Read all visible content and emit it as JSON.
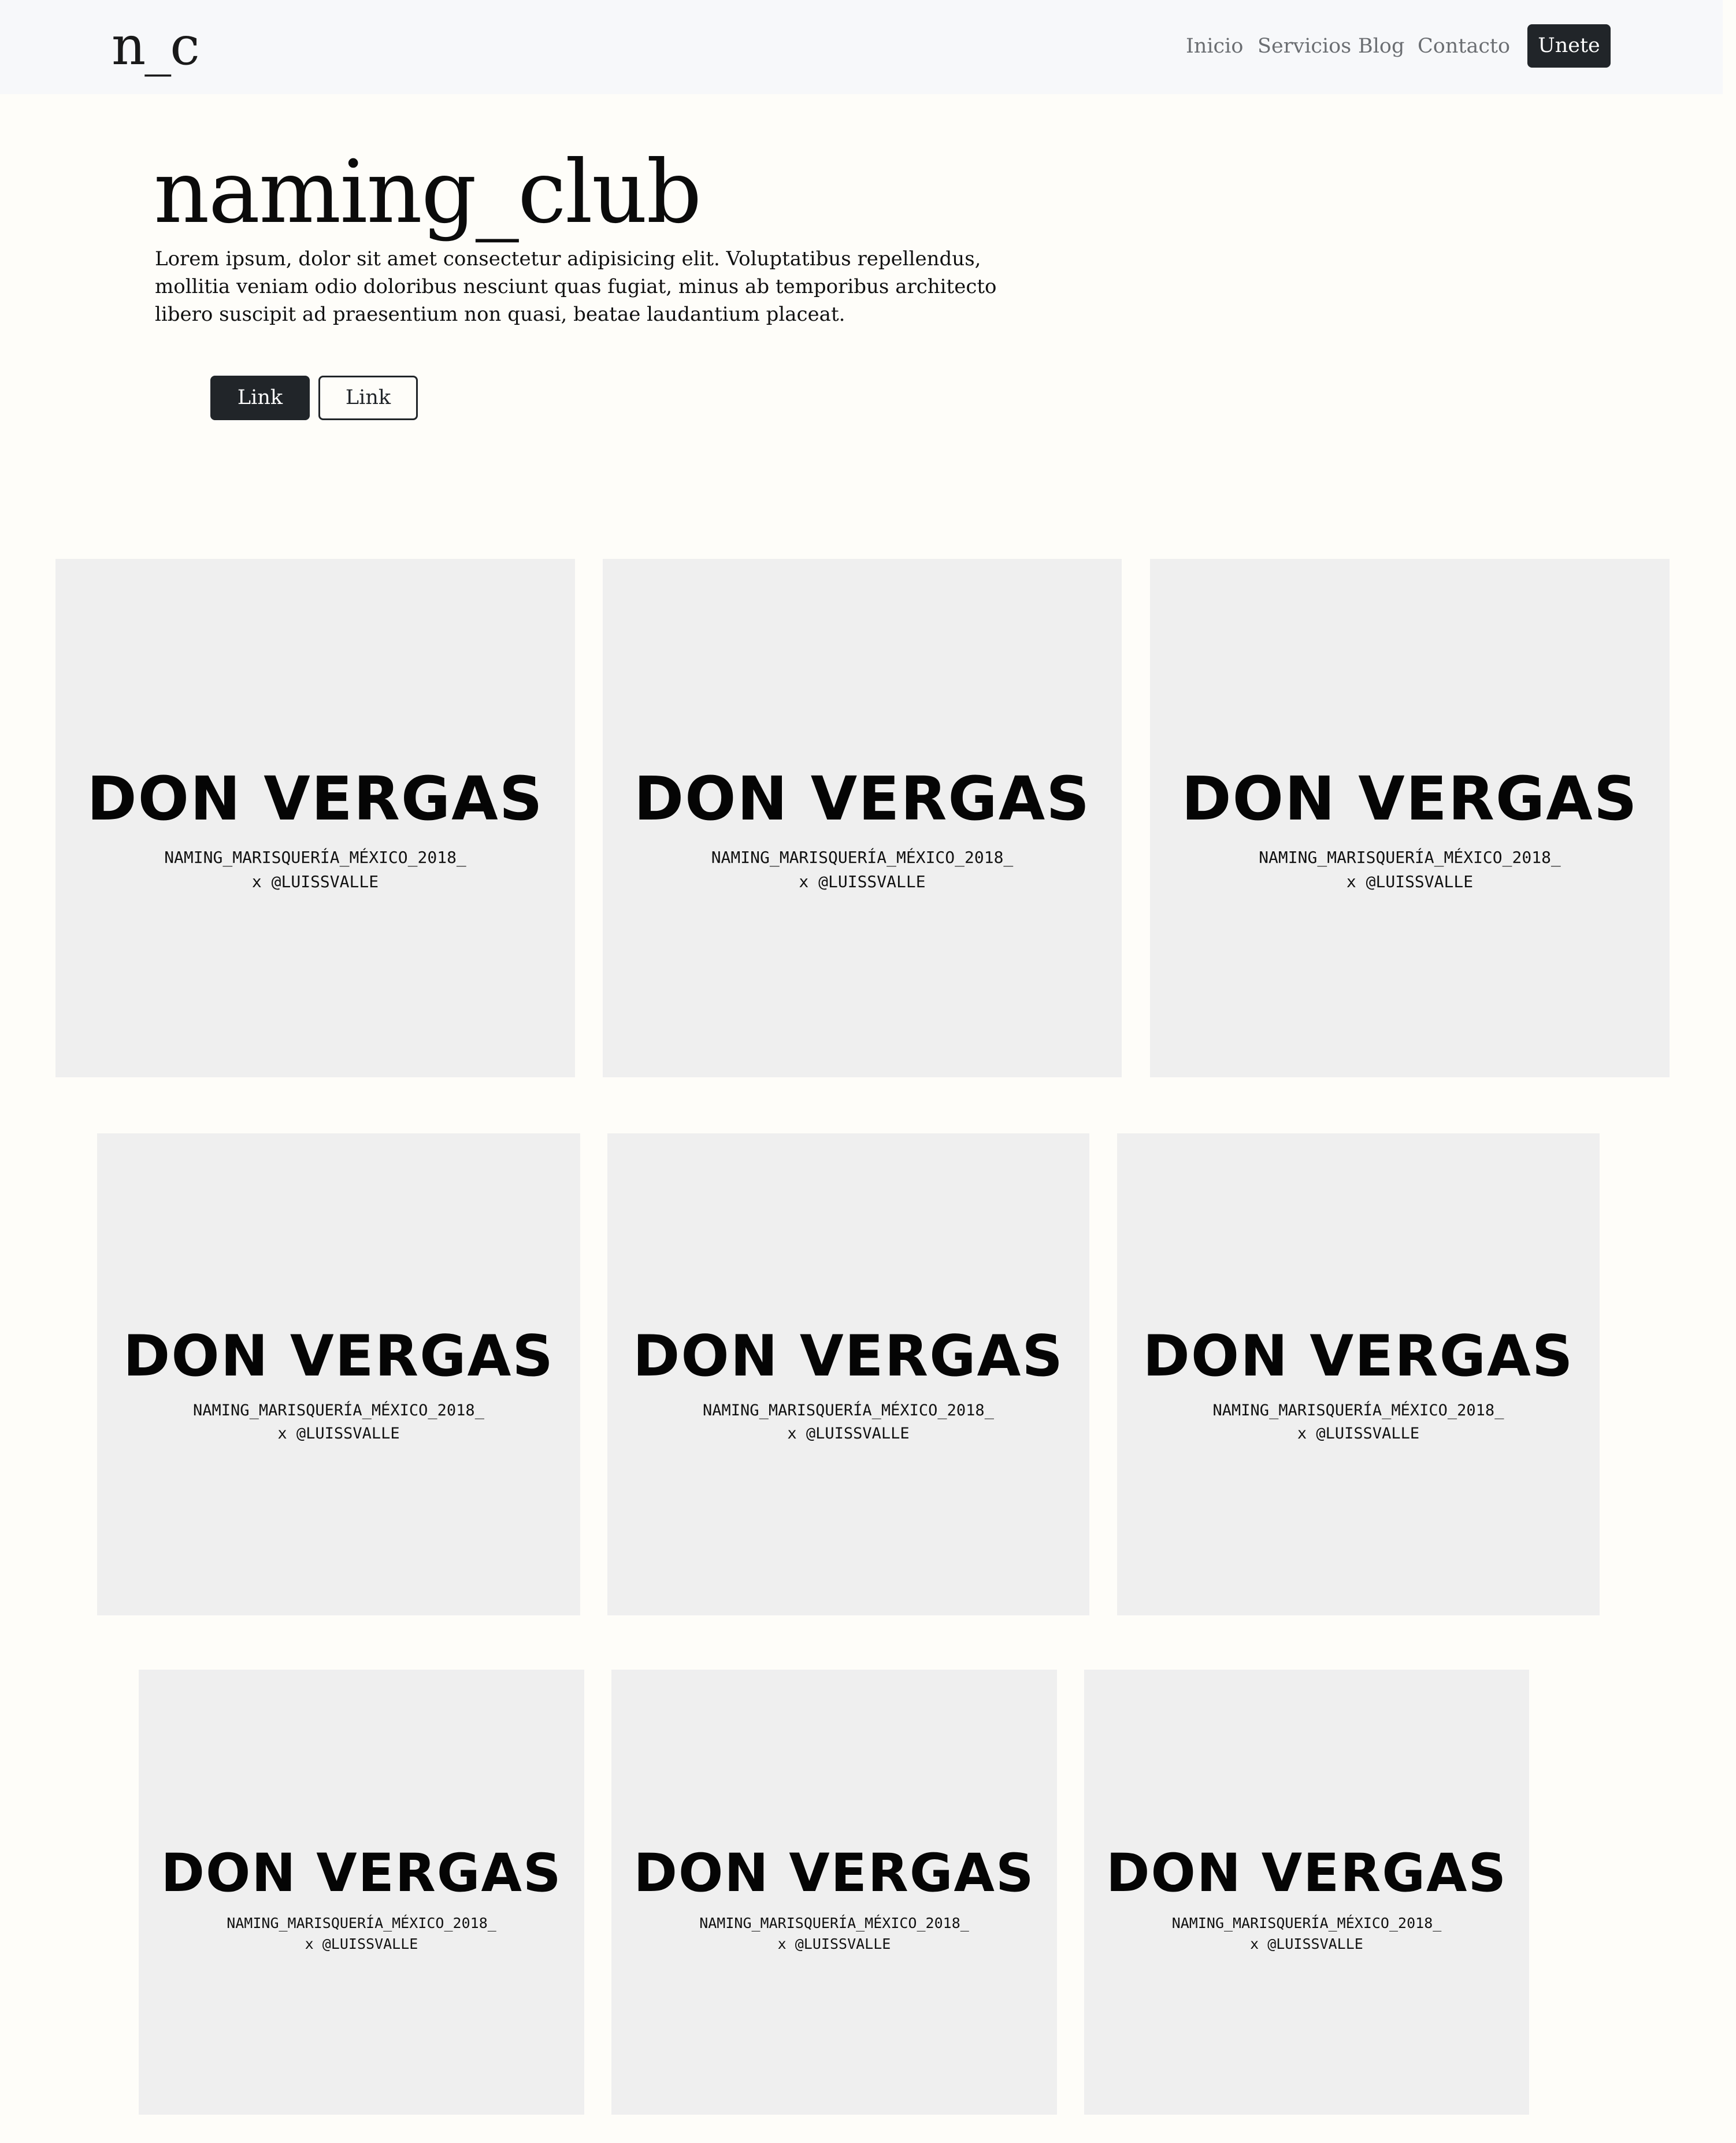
{
  "nav": {
    "brand": "n_c",
    "links": [
      "Inicio",
      "Servicios",
      "Blog",
      "Contacto"
    ],
    "cta": "Unete"
  },
  "hero": {
    "title": "naming_club",
    "text": "Lorem ipsum, dolor sit amet consectetur adipisicing elit. Voluptatibus repellendus, mollitia veniam odio doloribus nesciunt quas fugiat, minus ab temporibus architecto libero suscipit ad praesentium non quasi, beatae laudantium placeat.",
    "primary_button": "Link",
    "secondary_button": "Link"
  },
  "gallery": {
    "cards": [
      {
        "name": "DON VERGAS",
        "caption_line1": "NAMING_MARISQUERÍA_MÉXICO_2018_",
        "caption_line2": "x @LUISSVALLE"
      },
      {
        "name": "DON VERGAS",
        "caption_line1": "NAMING_MARISQUERÍA_MÉXICO_2018_",
        "caption_line2": "x @LUISSVALLE"
      },
      {
        "name": "DON VERGAS",
        "caption_line1": "NAMING_MARISQUERÍA_MÉXICO_2018_",
        "caption_line2": "x @LUISSVALLE"
      },
      {
        "name": "DON VERGAS",
        "caption_line1": "NAMING_MARISQUERÍA_MÉXICO_2018_",
        "caption_line2": "x @LUISSVALLE"
      },
      {
        "name": "DON VERGAS",
        "caption_line1": "NAMING_MARISQUERÍA_MÉXICO_2018_",
        "caption_line2": "x @LUISSVALLE"
      },
      {
        "name": "DON VERGAS",
        "caption_line1": "NAMING_MARISQUERÍA_MÉXICO_2018_",
        "caption_line2": "x @LUISSVALLE"
      },
      {
        "name": "DON VERGAS",
        "caption_line1": "NAMING_MARISQUERÍA_MÉXICO_2018_",
        "caption_line2": "x @LUISSVALLE"
      },
      {
        "name": "DON VERGAS",
        "caption_line1": "NAMING_MARISQUERÍA_MÉXICO_2018_",
        "caption_line2": "x @LUISSVALLE"
      },
      {
        "name": "DON VERGAS",
        "caption_line1": "NAMING_MARISQUERÍA_MÉXICO_2018_",
        "caption_line2": "x @LUISSVALLE"
      }
    ]
  }
}
